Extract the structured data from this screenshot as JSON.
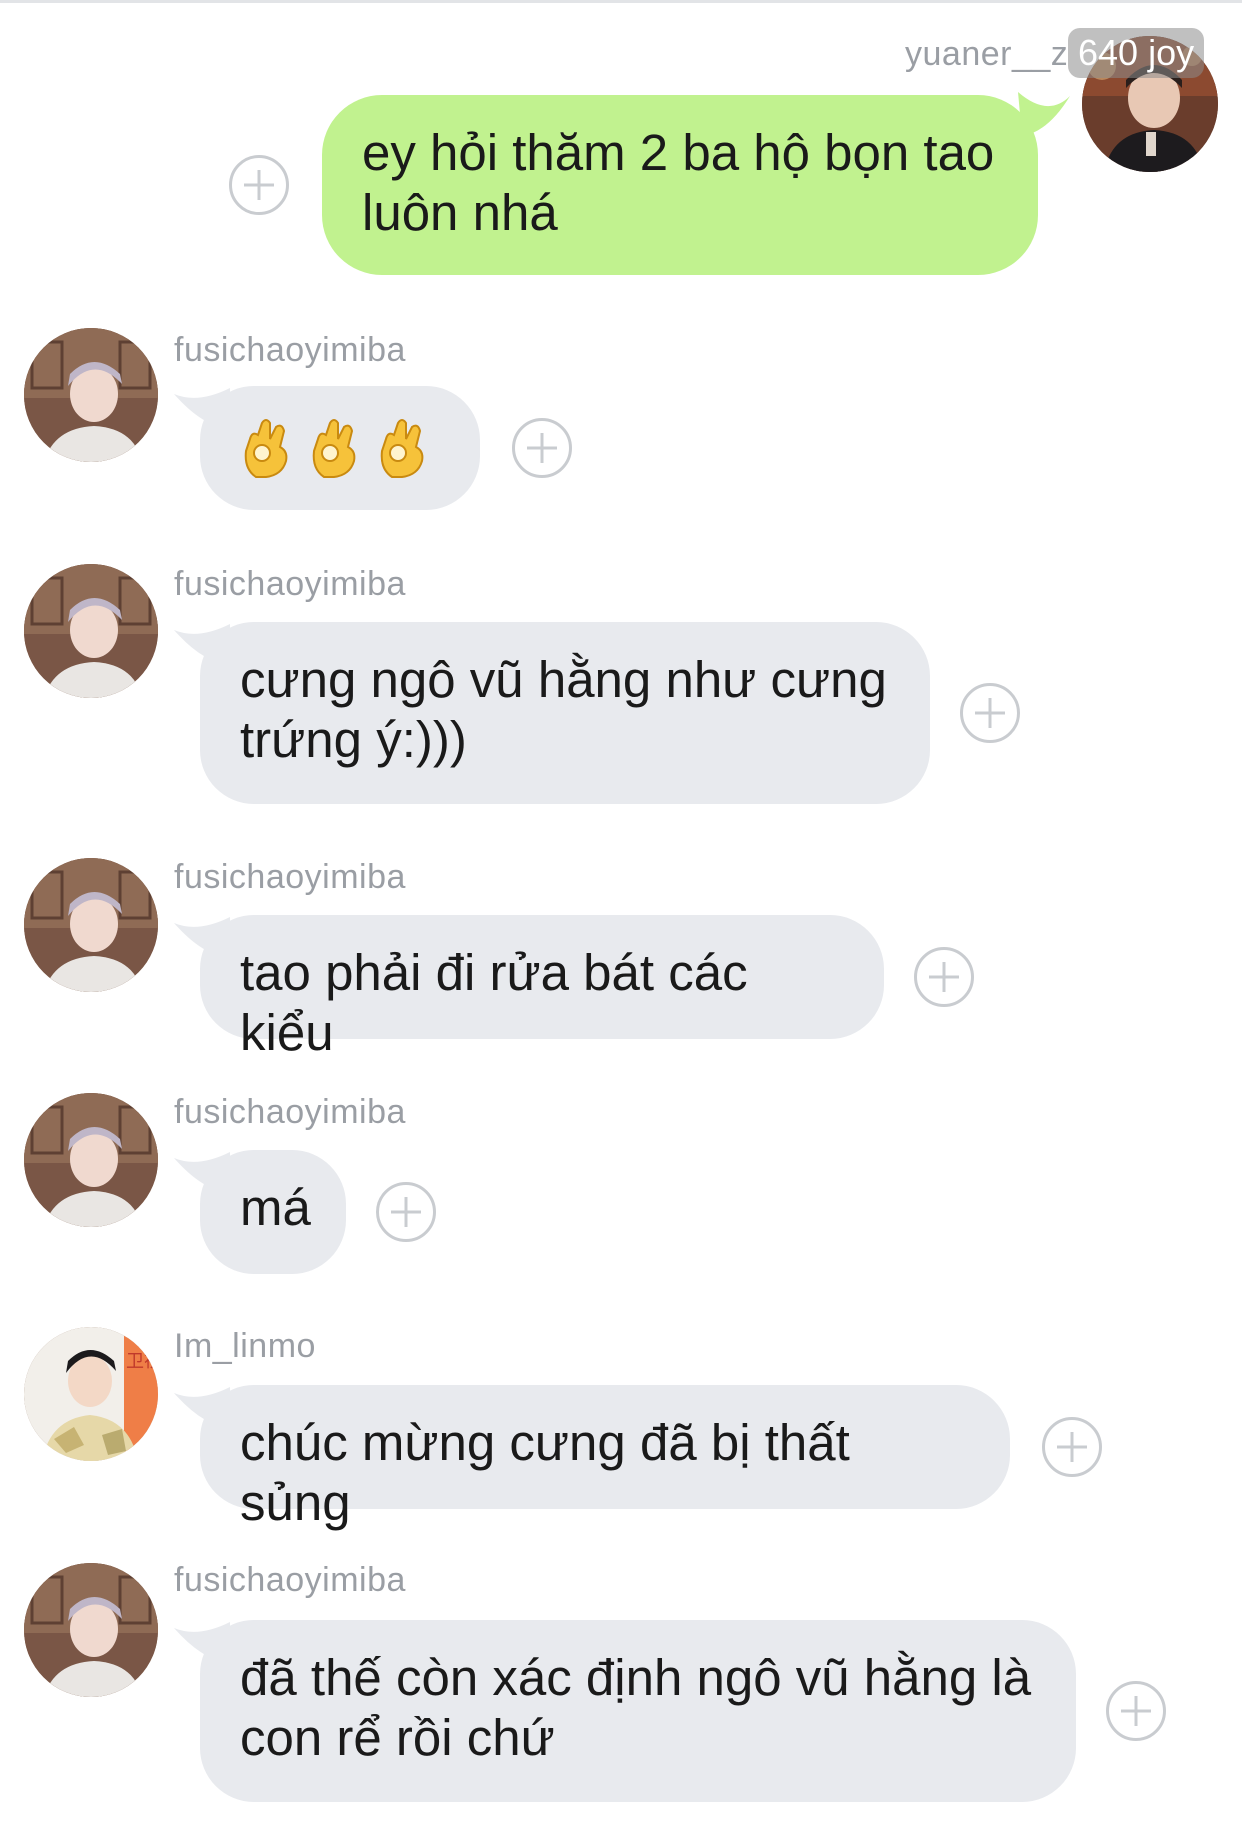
{
  "chat": {
    "my_message": {
      "sender": "yuaner__z",
      "badge": "640 joy",
      "text": "ey hỏi thăm 2 ba hộ bọn tao\nluôn nhá"
    },
    "messages": [
      {
        "sender": "fusichaoyimiba",
        "avatar": "avatar-fusichaoyimiba",
        "emoji": [
          "ok-hand",
          "ok-hand",
          "ok-hand"
        ],
        "text": ""
      },
      {
        "sender": "fusichaoyimiba",
        "avatar": "avatar-fusichaoyimiba",
        "text": "cưng ngô vũ hằng như cưng\ntrứng ý:)))"
      },
      {
        "sender": "fusichaoyimiba",
        "avatar": "avatar-fusichaoyimiba",
        "text": "tao phải đi rửa bát các kiểu"
      },
      {
        "sender": "fusichaoyimiba",
        "avatar": "avatar-fusichaoyimiba",
        "text": "má"
      },
      {
        "sender": "Im_linmo",
        "avatar": "avatar-im-linmo",
        "text": "chúc mừng cưng đã bị thất sủng"
      },
      {
        "sender": "fusichaoyimiba",
        "avatar": "avatar-fusichaoyimiba",
        "text": "đã thế còn xác định ngô vũ hằng là\ncon rể rồi chứ"
      }
    ]
  },
  "colors": {
    "outgoing_bubble": "#c1f28f",
    "incoming_bubble": "#e8eaee",
    "sender_text": "#9a9ea4",
    "plus_icon": "#c9ccd0"
  }
}
